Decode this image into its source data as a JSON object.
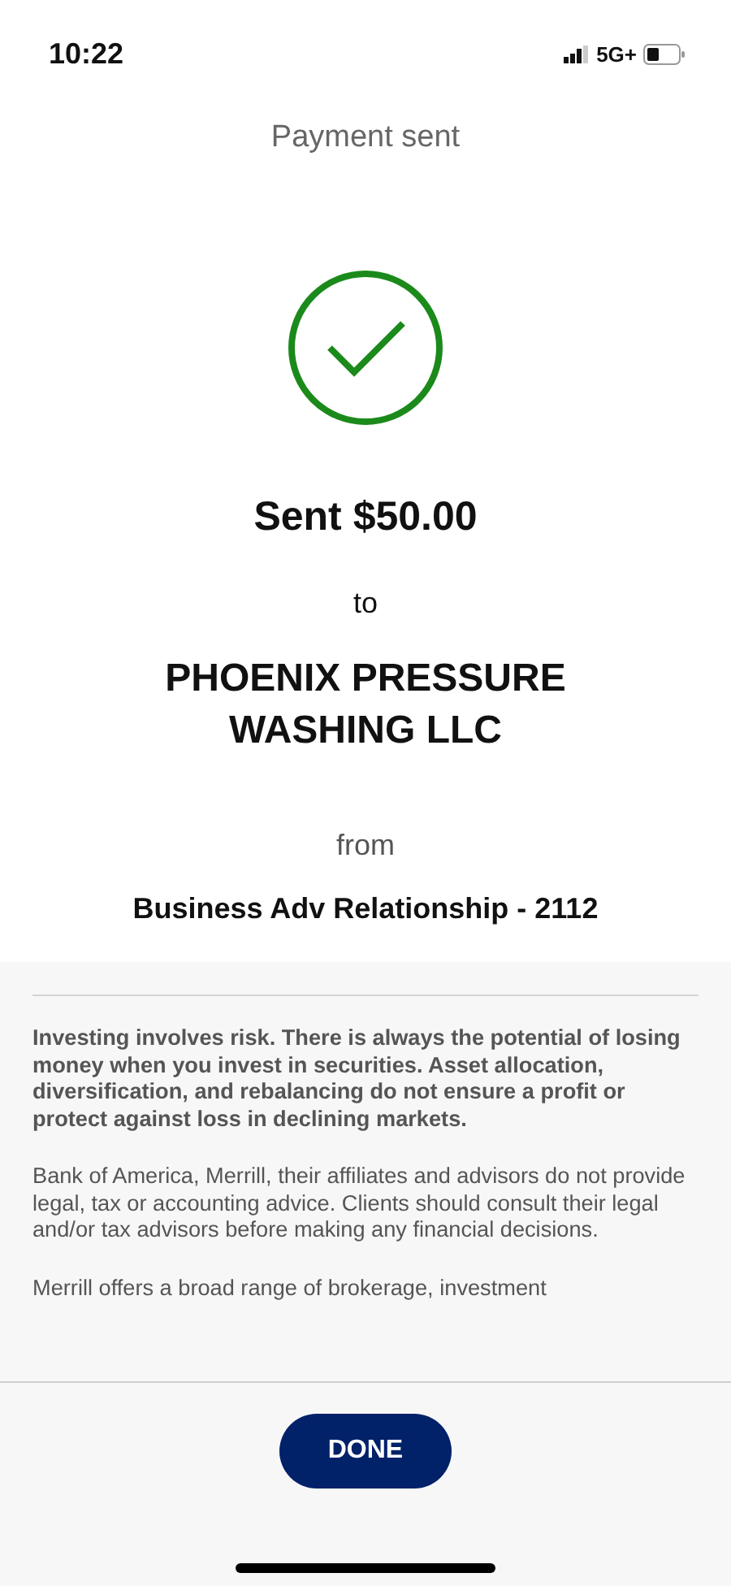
{
  "status_bar": {
    "time": "10:22",
    "network": "5G+"
  },
  "title": "Payment sent",
  "confirmation": {
    "amount_line": "Sent $50.00",
    "to_label": "to",
    "recipient": "PHOENIX PRESSURE WASHING LLC",
    "from_label": "from",
    "account": "Business Adv Relationship - 2112"
  },
  "disclosures": [
    {
      "text": "Investing involves risk. There is always the potential of losing money when you invest in securities. Asset allocation, diversification, and rebalancing do not ensure a profit or protect against loss in declining markets.",
      "bold": true
    },
    {
      "text": "Bank of America, Merrill, their affiliates and advisors do not provide legal, tax or accounting advice. Clients should consult their legal and/or tax advisors before making any financial decisions.",
      "bold": false
    },
    {
      "text": "Merrill offers a broad range of brokerage, investment",
      "bold": false
    }
  ],
  "done_button": "DONE"
}
